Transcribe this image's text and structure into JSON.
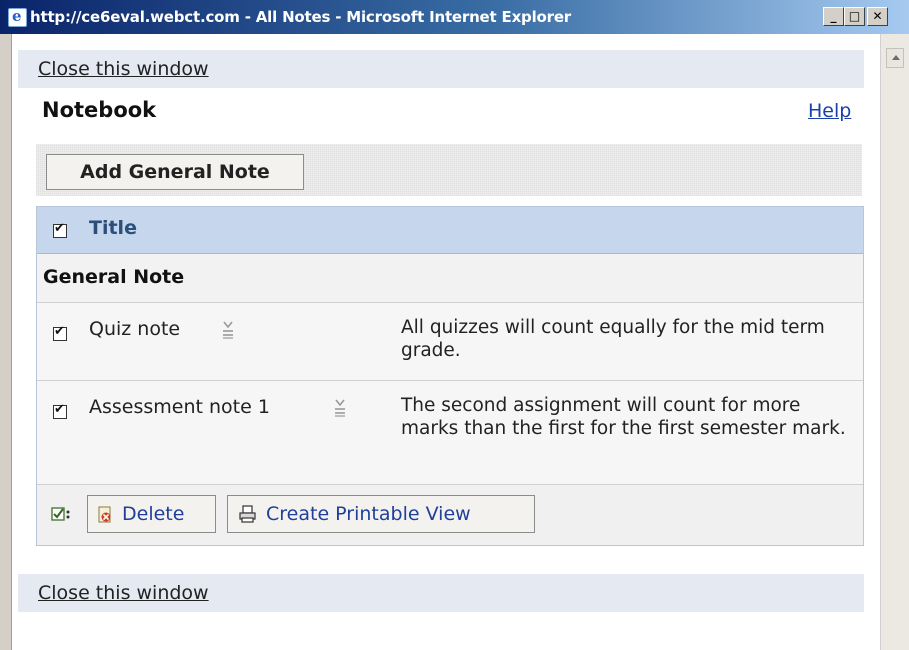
{
  "window": {
    "title": "http://ce6eval.webct.com - All Notes - Microsoft Internet Explorer",
    "min": "_",
    "max": "□",
    "close": "✕"
  },
  "close_link": "Close this window",
  "heading": "Notebook",
  "help": "Help",
  "add_note_button": "Add General Note",
  "table": {
    "header": "Title",
    "section": "General Note",
    "rows": [
      {
        "title": "Quiz note",
        "description": "All quizzes will count equally for the mid term grade."
      },
      {
        "title": "Assessment note 1",
        "description": "The second assignment will count for more marks than the first for the first semester mark."
      }
    ]
  },
  "actions": {
    "delete": "Delete",
    "printable": "Create Printable View"
  }
}
